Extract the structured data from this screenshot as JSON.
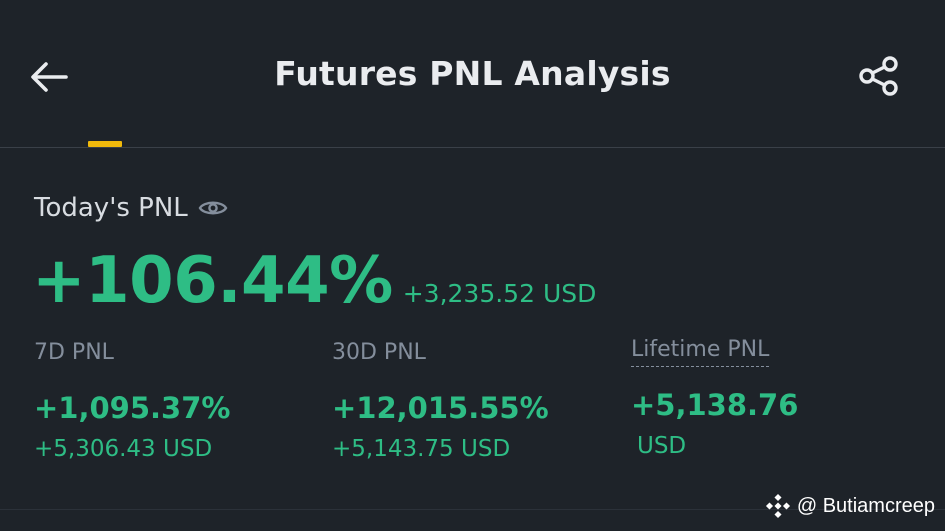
{
  "header": {
    "title": "Futures PNL Analysis",
    "back_icon": "arrow-left-icon",
    "share_icon": "share-icon"
  },
  "colors": {
    "background": "#1e2329",
    "profit_green": "#2ebd85",
    "tab_indicator": "#f0b90b",
    "muted_text": "#848e9c"
  },
  "today": {
    "label": "Today's PNL",
    "visibility_icon": "eye-icon",
    "percent": "+106.44%",
    "usd": "+3,235.52 USD"
  },
  "stats": [
    {
      "label": "7D PNL",
      "percent": "+1,095.37%",
      "usd": "+5,306.43 USD"
    },
    {
      "label": "30D PNL",
      "percent": "+12,015.55%",
      "usd": "+5,143.75 USD"
    },
    {
      "label": "Lifetime PNL",
      "value": "+5,138.76",
      "unit": "USD"
    }
  ],
  "watermark": {
    "text": "@ Butiamcreep",
    "logo_icon": "binance-logo-icon"
  }
}
